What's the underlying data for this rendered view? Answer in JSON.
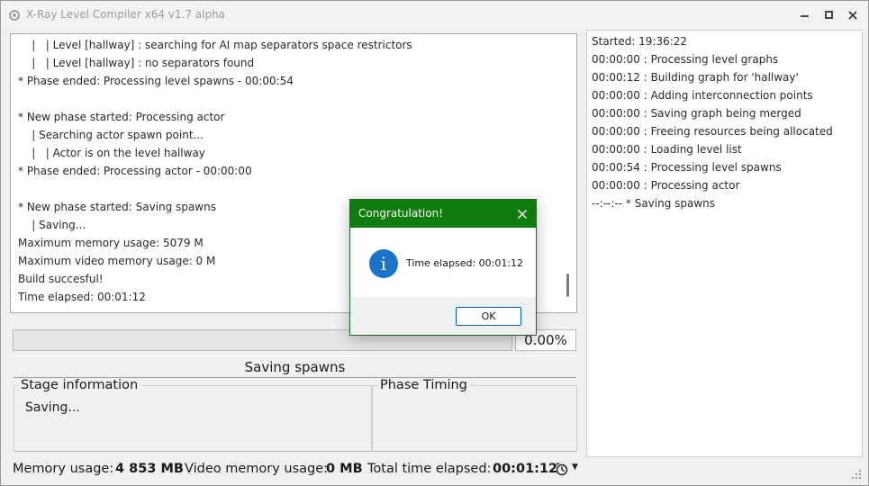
{
  "window": {
    "title": "X-Ray Level Compiler x64 v1.7 alpha"
  },
  "log": {
    "lines": [
      "    |   | Level [hallway] : searching for AI map separators space restrictors",
      "    |   | Level [hallway] : no separators found",
      "* Phase ended: Processing level spawns - 00:00:54",
      "",
      "* New phase started: Processing actor",
      "    | Searching actor spawn point...",
      "    |   | Actor is on the level hallway",
      "* Phase ended: Processing actor - 00:00:00",
      "",
      "* New phase started: Saving spawns",
      "    | Saving...",
      "Maximum memory usage: 5079 M",
      "Maximum video memory usage: 0 M",
      "Build succesful!",
      "Time elapsed: 00:01:12"
    ]
  },
  "progress": {
    "percent": 0,
    "text": "0.00%"
  },
  "phase": {
    "name": "Saving spawns"
  },
  "stage": {
    "title": "Stage information",
    "info": "Saving..."
  },
  "timing": {
    "title": "Phase Timing",
    "lines": [
      "Started: 19:36:22",
      "00:00:00 : Processing level graphs",
      "00:00:12 : Building graph for 'hallway'",
      "00:00:00 : Adding interconnection points",
      "00:00:00 : Saving graph being merged",
      "00:00:00 : Freeing resources being allocated",
      "00:00:00 : Loading level list",
      "00:00:54 : Processing level spawns",
      "00:00:00 : Processing actor",
      "--:--:-- * Saving spawns"
    ]
  },
  "status": {
    "memory_label": "Memory usage:",
    "memory_value": "4 853 MB",
    "video_memory_label": "Video memory usage:",
    "video_memory_value": "0 MB",
    "total_time_label": "Total time elapsed:",
    "total_time_value": "00:01:12"
  },
  "dialog": {
    "title": "Congratulation!",
    "message": "Time elapsed: 00:01:12",
    "ok_label": "OK"
  },
  "colors": {
    "dialog_titlebar": "#107c10",
    "progress_fill": "#06b025",
    "info_icon": "#1a73c9"
  },
  "icons": {
    "app": "app-icon",
    "minimize": "minimize-icon",
    "maximize": "maximize-icon",
    "close": "close-icon",
    "info": "info-icon",
    "timer": "timer-icon",
    "dropdown": "chevron-down-icon",
    "grip": "resize-grip-icon"
  }
}
